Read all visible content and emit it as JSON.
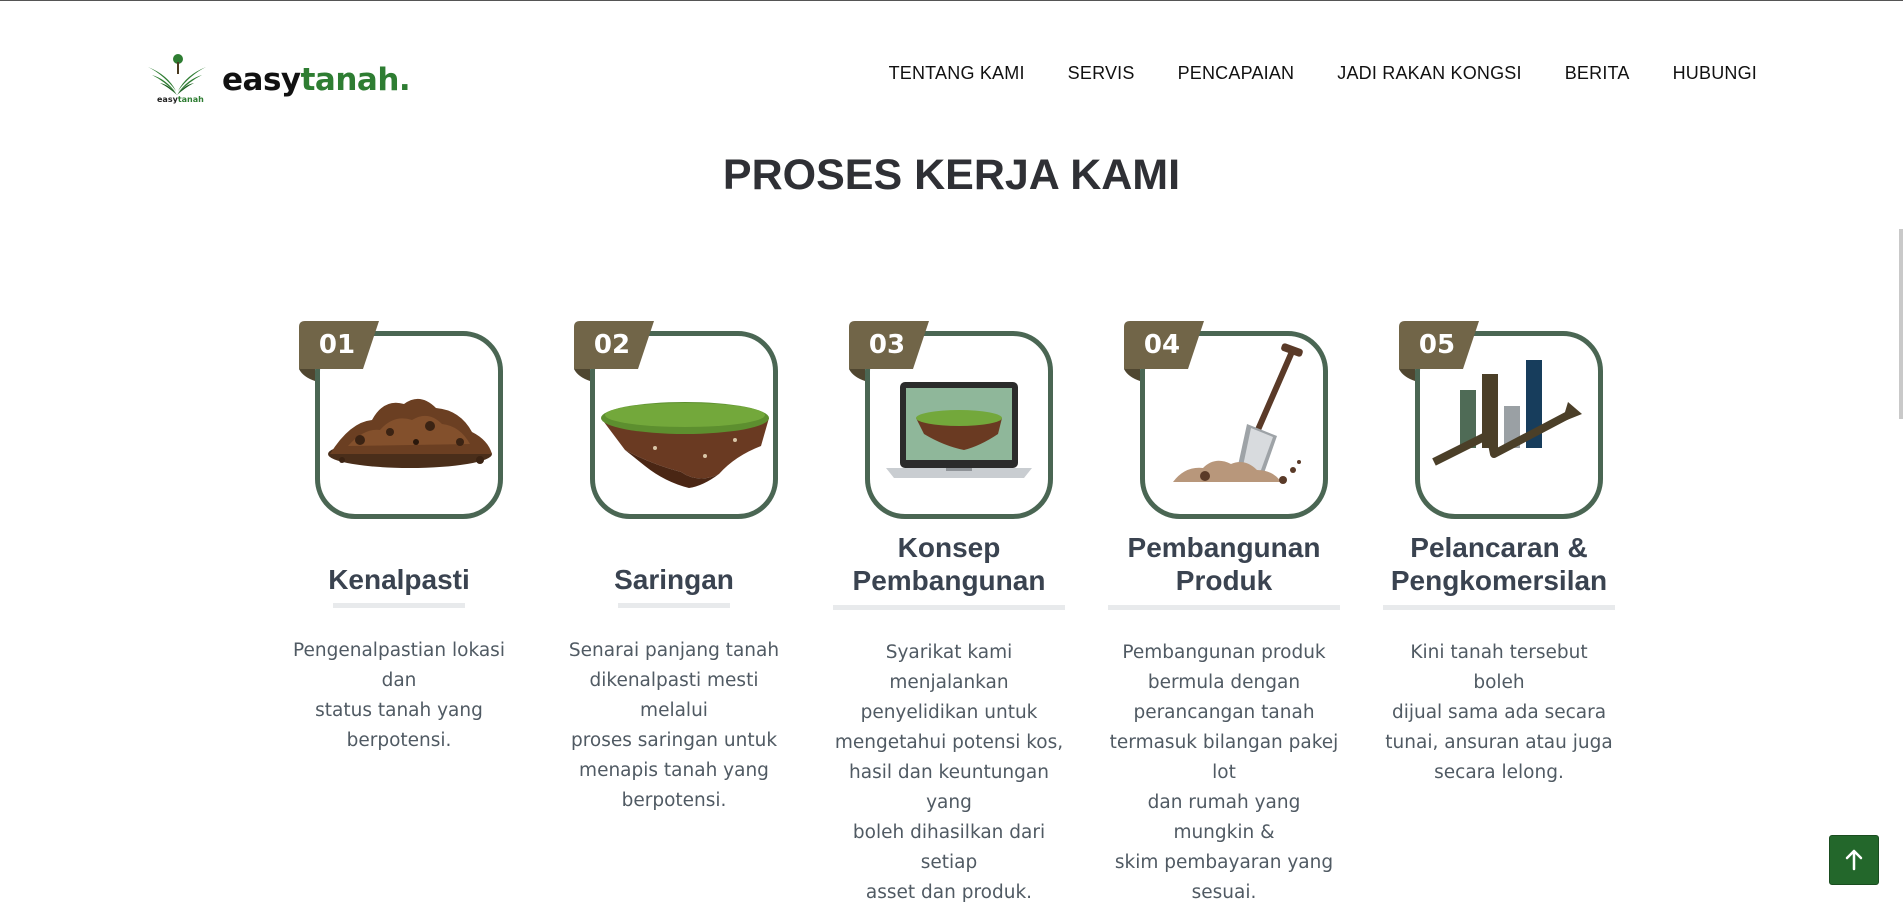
{
  "brand": {
    "name_part1": "easy",
    "name_part2": "tanah",
    "name_dot": ".",
    "mark_part1": "easy",
    "mark_part2": "tanah",
    "color_green": "#2e7d32"
  },
  "nav": {
    "items": [
      {
        "label": "TENTANG KAMI"
      },
      {
        "label": "SERVIS"
      },
      {
        "label": "PENCAPAIAN"
      },
      {
        "label": "JADI RAKAN KONGSI"
      },
      {
        "label": "BERITA"
      },
      {
        "label": "HUBUNGI"
      }
    ]
  },
  "section": {
    "title": "PROSES KERJA KAMI"
  },
  "steps": [
    {
      "number": "01",
      "title_line1": "Kenalpasti",
      "title_line2": "",
      "icon": "soil-pile-icon",
      "desc_lines": [
        "Pengenalpastian lokasi dan",
        "status tanah yang",
        "berpotensi."
      ]
    },
    {
      "number": "02",
      "title_line1": "Saringan",
      "title_line2": "",
      "icon": "land-plot-icon",
      "desc_lines": [
        "Senarai panjang tanah",
        "dikenalpasti mesti melalui",
        "proses saringan untuk",
        "menapis tanah yang",
        "berpotensi."
      ]
    },
    {
      "number": "03",
      "title_line1": "Konsep",
      "title_line2": "Pembangunan",
      "icon": "laptop-land-icon",
      "desc_lines": [
        "Syarikat kami menjalankan",
        "penyelidikan untuk",
        "mengetahui potensi kos,",
        "hasil dan keuntungan yang",
        "boleh dihasilkan dari setiap",
        "asset dan produk."
      ]
    },
    {
      "number": "04",
      "title_line1": "Pembangunan",
      "title_line2": "Produk",
      "icon": "shovel-icon",
      "desc_lines": [
        "Pembangunan produk",
        "bermula dengan",
        "perancangan tanah",
        "termasuk bilangan pakej lot",
        "dan rumah yang mungkin &",
        "skim pembayaran yang",
        "sesuai."
      ]
    },
    {
      "number": "05",
      "title_line1": "Pelancaran &",
      "title_line2": "Pengkomersilan",
      "icon": "growth-chart-icon",
      "desc_lines": [
        "Kini tanah tersebut boleh",
        "dijual sama ada secara",
        "tunai, ansuran atau juga",
        "secara lelong."
      ]
    }
  ],
  "scroll_top": {
    "icon": "arrow-up-icon",
    "color": "#23672b"
  }
}
